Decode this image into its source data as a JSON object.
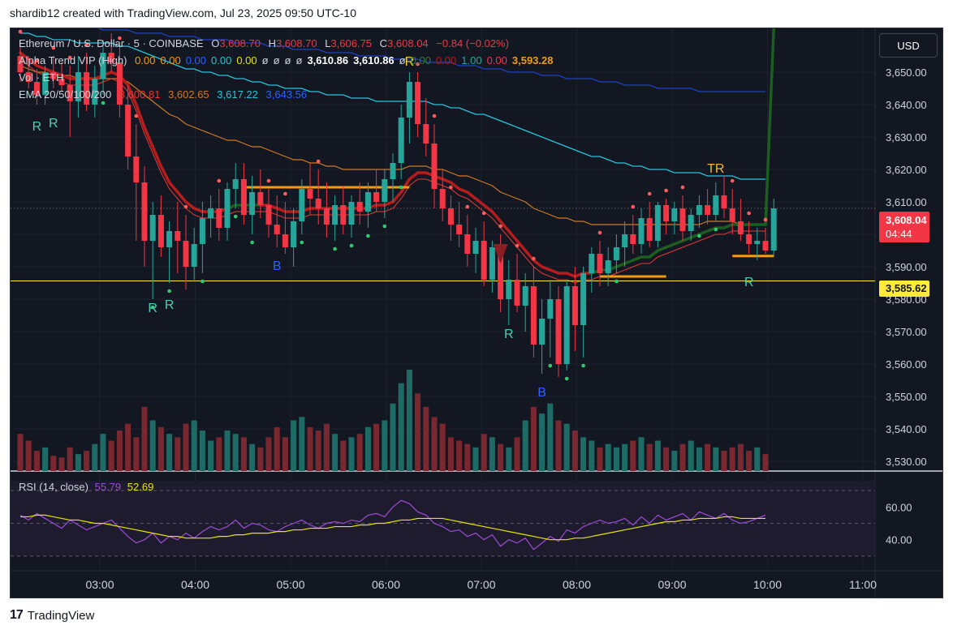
{
  "header": {
    "caption": "shardib12 created with TradingView.com, Jul 23, 2025 09:50 UTC-10"
  },
  "legend": {
    "symbol": "Ethereum / U.S. Dollar · 5 · COINBASE",
    "o_label": "O",
    "o": "3,608.70",
    "h_label": "H",
    "h": "3,608.70",
    "l_label": "L",
    "l": "3,606.75",
    "c_label": "C",
    "c": "3,608.04",
    "change": "−0.84 (−0.02%)",
    "alpha_name": "Alpha Trend VIP (High)",
    "alpha_values": [
      "0.00",
      "0.00",
      "0.00",
      "0.00",
      "0.00",
      "ø",
      "ø",
      "ø",
      "ø",
      "3,610.86",
      "3,610.86",
      "ø",
      "0.00",
      "0.00",
      "1.00",
      "0.00",
      "3,593.28"
    ],
    "vol_name": "Vol · ETH",
    "ema_name": "EMA 20/50/100/200",
    "ema_values": [
      "3,600.81",
      "3,602.65",
      "3,617.22",
      "3,643.56"
    ]
  },
  "rsi": {
    "name": "RSI (14, close)",
    "value": "55.79",
    "ma": "52.69"
  },
  "currency_button": "USD",
  "price_tag": {
    "price": "3,608.04",
    "countdown": "04:44"
  },
  "level_tag": "3,585.62",
  "price_axis_labels": [
    "3,650.00",
    "3,640.00",
    "3,630.00",
    "3,620.00",
    "3,610.00",
    "3,600.00",
    "3,590.00",
    "3,580.00",
    "3,570.00",
    "3,560.00",
    "3,550.00",
    "3,540.00",
    "3,530.00"
  ],
  "rsi_axis_labels": [
    "60.00",
    "40.00"
  ],
  "time_axis_labels": [
    "03:00",
    "04:00",
    "05:00",
    "06:00",
    "07:00",
    "08:00",
    "09:00",
    "10:00",
    "11:00"
  ],
  "footer_brand": "TradingView",
  "colors": {
    "bg": "#131722",
    "up": "#26a69a",
    "down": "#f23645",
    "ema20": "#b71c1c",
    "ema50": "#d17a22",
    "ema100": "#26c6da",
    "ema200": "#1e40c8",
    "rsi": "#9c4dd6",
    "rsi_ma": "#e6e600",
    "level": "#ffeb3b"
  },
  "chart_data": {
    "type": "candlestick",
    "ylim": [
      3527,
      3662
    ],
    "level": 3585.62,
    "last_close": 3608.04,
    "candles": [
      [
        3655,
        3660,
        3647,
        3650
      ],
      [
        3650,
        3655,
        3645,
        3647
      ],
      [
        3647,
        3651,
        3640,
        3643
      ],
      [
        3643,
        3652,
        3640,
        3650
      ],
      [
        3650,
        3655,
        3645,
        3648
      ],
      [
        3648,
        3653,
        3644,
        3646
      ],
      [
        3646,
        3652,
        3630,
        3641
      ],
      [
        3641,
        3655,
        3636,
        3650
      ],
      [
        3650,
        3656,
        3638,
        3640
      ],
      [
        3640,
        3652,
        3636,
        3648
      ],
      [
        3648,
        3660,
        3643,
        3656
      ],
      [
        3656,
        3662,
        3650,
        3653
      ],
      [
        3653,
        3658,
        3636,
        3640
      ],
      [
        3640,
        3646,
        3620,
        3624
      ],
      [
        3624,
        3634,
        3598,
        3616
      ],
      [
        3616,
        3621,
        3590,
        3598
      ],
      [
        3598,
        3610,
        3580,
        3606
      ],
      [
        3606,
        3612,
        3593,
        3596
      ],
      [
        3596,
        3604,
        3585,
        3601
      ],
      [
        3601,
        3610,
        3588,
        3598
      ],
      [
        3598,
        3606,
        3583,
        3590
      ],
      [
        3590,
        3602,
        3586,
        3597
      ],
      [
        3597,
        3610,
        3588,
        3605
      ],
      [
        3605,
        3612,
        3599,
        3608
      ],
      [
        3608,
        3614,
        3598,
        3602
      ],
      [
        3602,
        3616,
        3598,
        3614
      ],
      [
        3614,
        3622,
        3608,
        3617
      ],
      [
        3617,
        3622,
        3603,
        3606
      ],
      [
        3606,
        3618,
        3600,
        3613
      ],
      [
        3613,
        3620,
        3605,
        3609
      ],
      [
        3609,
        3614,
        3599,
        3603
      ],
      [
        3603,
        3612,
        3596,
        3600
      ],
      [
        3600,
        3610,
        3594,
        3596
      ],
      [
        3596,
        3608,
        3590,
        3604
      ],
      [
        3604,
        3617,
        3600,
        3614
      ],
      [
        3614,
        3622,
        3606,
        3611
      ],
      [
        3611,
        3620,
        3603,
        3608
      ],
      [
        3608,
        3616,
        3599,
        3603
      ],
      [
        3603,
        3612,
        3598,
        3609
      ],
      [
        3609,
        3615,
        3600,
        3603
      ],
      [
        3603,
        3612,
        3599,
        3610
      ],
      [
        3610,
        3616,
        3603,
        3607
      ],
      [
        3607,
        3616,
        3602,
        3613
      ],
      [
        3613,
        3620,
        3607,
        3610
      ],
      [
        3610,
        3620,
        3605,
        3617
      ],
      [
        3617,
        3625,
        3610,
        3622
      ],
      [
        3622,
        3640,
        3617,
        3636
      ],
      [
        3636,
        3650,
        3628,
        3647
      ],
      [
        3647,
        3650,
        3630,
        3634
      ],
      [
        3634,
        3642,
        3624,
        3628
      ],
      [
        3628,
        3634,
        3608,
        3614
      ],
      [
        3614,
        3620,
        3604,
        3608
      ],
      [
        3608,
        3612,
        3598,
        3603
      ],
      [
        3603,
        3610,
        3596,
        3600
      ],
      [
        3600,
        3606,
        3590,
        3594
      ],
      [
        3594,
        3602,
        3588,
        3598
      ],
      [
        3598,
        3604,
        3584,
        3586
      ],
      [
        3586,
        3598,
        3582,
        3596
      ],
      [
        3596,
        3600,
        3576,
        3580
      ],
      [
        3580,
        3592,
        3572,
        3586
      ],
      [
        3586,
        3594,
        3576,
        3578
      ],
      [
        3578,
        3588,
        3570,
        3584
      ],
      [
        3584,
        3590,
        3562,
        3566
      ],
      [
        3566,
        3580,
        3557,
        3574
      ],
      [
        3574,
        3586,
        3562,
        3580
      ],
      [
        3580,
        3584,
        3556,
        3560
      ],
      [
        3560,
        3586,
        3558,
        3584
      ],
      [
        3584,
        3590,
        3564,
        3572
      ],
      [
        3572,
        3590,
        3562,
        3588
      ],
      [
        3588,
        3596,
        3582,
        3594
      ],
      [
        3594,
        3598,
        3584,
        3588
      ],
      [
        3588,
        3596,
        3584,
        3592
      ],
      [
        3592,
        3600,
        3588,
        3596
      ],
      [
        3596,
        3604,
        3590,
        3600
      ],
      [
        3600,
        3606,
        3594,
        3597
      ],
      [
        3597,
        3608,
        3594,
        3605
      ],
      [
        3605,
        3610,
        3596,
        3598
      ],
      [
        3598,
        3610,
        3596,
        3609
      ],
      [
        3609,
        3611,
        3600,
        3604
      ],
      [
        3604,
        3610,
        3600,
        3608
      ],
      [
        3608,
        3612,
        3598,
        3601
      ],
      [
        3601,
        3608,
        3598,
        3606
      ],
      [
        3606,
        3612,
        3602,
        3609
      ],
      [
        3609,
        3614,
        3603,
        3606
      ],
      [
        3606,
        3616,
        3604,
        3612
      ],
      [
        3612,
        3618,
        3605,
        3608
      ],
      [
        3608,
        3614,
        3600,
        3604
      ],
      [
        3604,
        3611,
        3598,
        3600
      ],
      [
        3600,
        3604,
        3594,
        3597
      ],
      [
        3597,
        3602,
        3592,
        3598
      ],
      [
        3598,
        3602,
        3594,
        3595
      ],
      [
        3595,
        3611,
        3593,
        3608
      ]
    ],
    "volumes": [
      22,
      18,
      12,
      14,
      9,
      8,
      14,
      10,
      12,
      16,
      22,
      18,
      24,
      28,
      20,
      38,
      30,
      26,
      22,
      20,
      28,
      30,
      24,
      18,
      20,
      24,
      22,
      20,
      16,
      14,
      20,
      26,
      20,
      30,
      32,
      26,
      24,
      28,
      22,
      18,
      20,
      22,
      26,
      28,
      30,
      40,
      52,
      60,
      46,
      38,
      32,
      28,
      20,
      18,
      16,
      14,
      22,
      20,
      16,
      14,
      20,
      30,
      38,
      34,
      40,
      30,
      28,
      24,
      20,
      18,
      14,
      16,
      14,
      16,
      18,
      20,
      16,
      18,
      14,
      12,
      16,
      18,
      14,
      16,
      14,
      12,
      14,
      16,
      12,
      14,
      10
    ],
    "ema20": [
      3654,
      3652,
      3650,
      3649,
      3648,
      3647,
      3646,
      3646,
      3646,
      3646,
      3647,
      3648,
      3647,
      3644,
      3638,
      3631,
      3625,
      3619,
      3614,
      3611,
      3608,
      3606,
      3605,
      3605,
      3605,
      3606,
      3607,
      3607,
      3607,
      3607,
      3607,
      3606,
      3605,
      3605,
      3605,
      3606,
      3606,
      3606,
      3606,
      3606,
      3606,
      3606,
      3606,
      3607,
      3607,
      3608,
      3611,
      3615,
      3617,
      3617,
      3616,
      3615,
      3614,
      3612,
      3611,
      3609,
      3607,
      3605,
      3602,
      3599,
      3596,
      3593,
      3590,
      3588,
      3587,
      3586,
      3586,
      3585,
      3586,
      3586,
      3587,
      3587,
      3588,
      3589,
      3590,
      3591,
      3591,
      3593,
      3594,
      3595,
      3596,
      3597,
      3598,
      3599,
      3600,
      3600,
      3601,
      3601,
      3601,
      3601,
      3601
    ],
    "ema50": [
      3652,
      3651,
      3650,
      3650,
      3649,
      3649,
      3649,
      3648,
      3648,
      3648,
      3648,
      3648,
      3648,
      3647,
      3645,
      3643,
      3641,
      3639,
      3637,
      3636,
      3634,
      3633,
      3632,
      3631,
      3630,
      3629,
      3629,
      3628,
      3627,
      3627,
      3626,
      3625,
      3624,
      3623,
      3623,
      3622,
      3622,
      3621,
      3621,
      3620,
      3620,
      3620,
      3620,
      3620,
      3620,
      3620,
      3620,
      3621,
      3621,
      3621,
      3620,
      3620,
      3619,
      3618,
      3618,
      3617,
      3616,
      3615,
      3613,
      3612,
      3611,
      3610,
      3608,
      3607,
      3606,
      3605,
      3605,
      3604,
      3604,
      3603,
      3603,
      3603,
      3603,
      3603,
      3603,
      3603,
      3603,
      3603,
      3603,
      3603,
      3603,
      3603,
      3603,
      3604,
      3604,
      3604,
      3604,
      3603,
      3603,
      3603,
      3603
    ],
    "ema100": [
      3662,
      3662,
      3661,
      3661,
      3660,
      3660,
      3660,
      3659,
      3659,
      3659,
      3659,
      3659,
      3658,
      3658,
      3657,
      3656,
      3655,
      3654,
      3653,
      3652,
      3651,
      3651,
      3650,
      3650,
      3649,
      3649,
      3648,
      3648,
      3647,
      3647,
      3646,
      3646,
      3645,
      3645,
      3645,
      3644,
      3644,
      3643,
      3643,
      3643,
      3642,
      3642,
      3642,
      3641,
      3641,
      3641,
      3641,
      3641,
      3641,
      3641,
      3640,
      3640,
      3639,
      3639,
      3638,
      3637,
      3637,
      3636,
      3635,
      3634,
      3633,
      3632,
      3631,
      3630,
      3629,
      3628,
      3627,
      3626,
      3625,
      3624,
      3624,
      3623,
      3622,
      3622,
      3621,
      3621,
      3620,
      3620,
      3620,
      3619,
      3619,
      3619,
      3619,
      3618,
      3618,
      3618,
      3618,
      3617,
      3617,
      3617,
      3617
    ],
    "ema200": [
      3665,
      3665,
      3665,
      3665,
      3664,
      3664,
      3664,
      3664,
      3664,
      3664,
      3663,
      3663,
      3663,
      3663,
      3662,
      3662,
      3662,
      3662,
      3661,
      3661,
      3661,
      3661,
      3660,
      3660,
      3660,
      3660,
      3659,
      3659,
      3659,
      3659,
      3658,
      3658,
      3658,
      3657,
      3657,
      3657,
      3657,
      3656,
      3656,
      3656,
      3656,
      3655,
      3655,
      3655,
      3655,
      3654,
      3654,
      3654,
      3654,
      3653,
      3653,
      3653,
      3653,
      3652,
      3652,
      3652,
      3651,
      3651,
      3651,
      3650,
      3650,
      3650,
      3650,
      3649,
      3649,
      3649,
      3648,
      3648,
      3648,
      3648,
      3647,
      3647,
      3647,
      3646,
      3646,
      3646,
      3646,
      3645,
      3645,
      3645,
      3645,
      3645,
      3644,
      3644,
      3644,
      3644,
      3644,
      3644,
      3644,
      3644,
      3644
    ],
    "signals": [
      {
        "i": 2,
        "label": "R",
        "color": "#4dd0b4",
        "where": "below",
        "price": 3632
      },
      {
        "i": 4,
        "label": "R",
        "color": "#4dd0b4",
        "where": "below",
        "price": 3633
      },
      {
        "i": 16,
        "label": "R",
        "color": "#4dd0b4",
        "where": "below",
        "price": 3576
      },
      {
        "i": 18,
        "label": "R",
        "color": "#4dd0b4",
        "where": "below",
        "price": 3577
      },
      {
        "i": 31,
        "label": "B",
        "color": "#2962ff",
        "where": "below",
        "price": 3589
      },
      {
        "i": 47,
        "label": "R",
        "color": "#f7d23b",
        "where": "above",
        "price": 3652
      },
      {
        "i": 59,
        "label": "R",
        "color": "#4dd0b4",
        "where": "below",
        "price": 3568
      },
      {
        "i": 63,
        "label": "B",
        "color": "#2962ff",
        "where": "below",
        "price": 3550
      },
      {
        "i": 84,
        "label": "TR",
        "color": "#f7b23b",
        "where": "above",
        "price": 3619
      },
      {
        "i": 88,
        "label": "R",
        "color": "#4dd0b4",
        "where": "below",
        "price": 3584
      }
    ],
    "alpha_lines": [
      {
        "from": 27,
        "to": 47,
        "price": 3614.5,
        "color": "#f39c12"
      },
      {
        "from": 70,
        "to": 78,
        "price": 3587,
        "color": "#f39c12"
      },
      {
        "from": 86,
        "to": 91,
        "price": 3593.3,
        "color": "#f39c12"
      }
    ],
    "rsi_values": [
      55,
      52,
      56,
      53,
      50,
      47,
      52,
      49,
      46,
      48,
      50,
      52,
      47,
      42,
      38,
      40,
      44,
      38,
      42,
      40,
      44,
      41,
      45,
      48,
      46,
      48,
      52,
      47,
      50,
      49,
      46,
      45,
      48,
      50,
      52,
      49,
      47,
      50,
      51,
      50,
      52,
      51,
      55,
      56,
      54,
      60,
      64,
      62,
      57,
      55,
      50,
      48,
      45,
      46,
      42,
      44,
      40,
      43,
      36,
      40,
      38,
      41,
      34,
      38,
      42,
      39,
      46,
      44,
      48,
      50,
      52,
      50,
      51,
      53,
      49,
      54,
      50,
      55,
      52,
      54,
      56,
      52,
      57,
      55,
      53,
      56,
      52,
      50,
      51,
      53,
      55
    ],
    "rsi_ma": [
      54,
      54,
      55,
      55,
      54,
      53,
      52,
      52,
      51,
      50,
      50,
      49,
      48,
      47,
      46,
      45,
      44,
      43,
      42,
      42,
      41,
      41,
      41,
      41,
      42,
      42,
      43,
      43,
      44,
      44,
      44,
      45,
      45,
      46,
      46,
      47,
      47,
      47,
      48,
      48,
      48,
      49,
      49,
      50,
      50,
      51,
      52,
      52,
      53,
      53,
      53,
      53,
      52,
      51,
      50,
      49,
      48,
      47,
      46,
      45,
      44,
      43,
      42,
      41,
      40,
      40,
      40,
      41,
      41,
      42,
      43,
      44,
      45,
      46,
      47,
      48,
      49,
      50,
      51,
      51,
      52,
      52,
      53,
      53,
      53,
      54,
      54,
      53,
      53,
      53,
      53
    ],
    "rsi_ylim": [
      25,
      75
    ]
  }
}
